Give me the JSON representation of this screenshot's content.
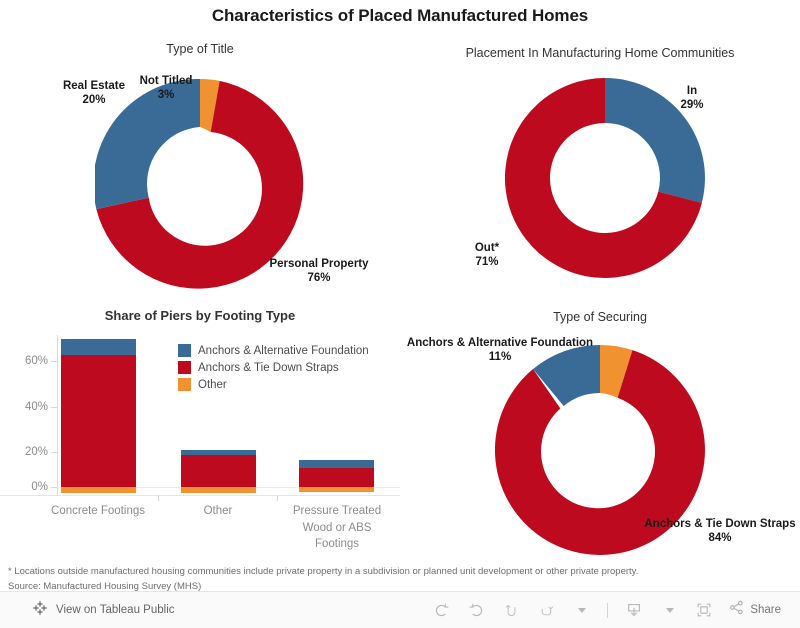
{
  "dashboard": {
    "title": "Characteristics of Placed Manufactured Homes",
    "footnote_1": "* Locations outside manufactured housing communities include private property in a subdivision or planned unit development or other private property.",
    "footnote_2": "Source: Manufactured Housing Survey (MHS)"
  },
  "colors": {
    "blue": "#3A6B96",
    "red": "#BD0A1E",
    "orange": "#F0922F",
    "axis": "#d9d9d9",
    "tick_text": "#8c8c8c"
  },
  "panels": {
    "type_of_title": {
      "title": "Type of Title"
    },
    "placement": {
      "title": "Placement In Manufacturing Home Communities"
    },
    "piers": {
      "title": "Share of Piers by Footing Type"
    },
    "securing": {
      "title": "Type of Securing"
    }
  },
  "chart_data": [
    {
      "id": "type-of-title",
      "type": "pie",
      "title": "Type of Title",
      "variant": "donut",
      "slices": [
        {
          "label": "Not Titled",
          "value": 3,
          "value_label": "3%",
          "color": "#F0922F"
        },
        {
          "label": "Personal Property",
          "value": 76,
          "value_label": "76%",
          "color": "#BD0A1E"
        },
        {
          "label": "Real Estate",
          "value": 20,
          "value_label": "20%",
          "color": "#3A6B96"
        }
      ],
      "units": "percent"
    },
    {
      "id": "placement-in-manufacturing-home-communities",
      "type": "pie",
      "title": "Placement In Manufacturing Home Communities",
      "variant": "donut",
      "slices": [
        {
          "label": "In",
          "value": 29,
          "value_label": "29%",
          "color": "#3A6B96"
        },
        {
          "label": "Out*",
          "value": 71,
          "value_label": "71%",
          "color": "#BD0A1E"
        }
      ],
      "units": "percent"
    },
    {
      "id": "share-of-piers-by-footing-type",
      "type": "bar",
      "subtype": "stacked",
      "title": "Share of Piers by Footing Type",
      "xlabel": "",
      "ylabel": "",
      "ylim": [
        -5,
        70
      ],
      "yticks": [
        0,
        20,
        40,
        60
      ],
      "ytick_labels": [
        "0%",
        "20%",
        "40%",
        "60%"
      ],
      "grid": false,
      "legend_position": "inside-top-right",
      "categories": [
        "Concrete Footings",
        "Other",
        "Pressure Treated Wood or ABS Footings"
      ],
      "series": [
        {
          "name": "Anchors & Alternative Foundation",
          "color": "#3A6B96",
          "values": [
            7,
            1,
            3
          ]
        },
        {
          "name": "Anchors & Tie Down Straps",
          "color": "#BD0A1E",
          "values": [
            61,
            16,
            10
          ]
        },
        {
          "name": "Other",
          "color": "#F0922F",
          "values": [
            -2,
            -2,
            -2
          ]
        }
      ]
    },
    {
      "id": "type-of-securing",
      "type": "pie",
      "title": "Type of Securing",
      "variant": "donut",
      "slices": [
        {
          "label": "Other",
          "value": 5,
          "value_label": "5%",
          "color": "#F0922F"
        },
        {
          "label": "Anchors & Tie Down Straps",
          "value": 84,
          "value_label": "84%",
          "color": "#BD0A1E"
        },
        {
          "label": "Anchors & Alternative Foundation",
          "value": 11,
          "value_label": "11%",
          "color": "#3A6B96"
        }
      ],
      "units": "percent"
    }
  ],
  "labels": {
    "title_real_estate": "Real Estate",
    "title_real_estate_pct": "20%",
    "title_not_titled": "Not Titled",
    "title_not_titled_pct": "3%",
    "title_personal_property": "Personal Property",
    "title_personal_property_pct": "76%",
    "placement_in": "In",
    "placement_in_pct": "29%",
    "placement_out": "Out*",
    "placement_out_pct": "71%",
    "securing_alt_foundation": "Anchors & Alternative Foundation",
    "securing_alt_foundation_pct": "11%",
    "securing_tie_down": "Anchors & Tie Down Straps",
    "securing_tie_down_pct": "84%"
  },
  "bar_axis": {
    "ticks": [
      "60%",
      "40%",
      "20%",
      "0%"
    ],
    "categories": [
      "Concrete Footings",
      "Other",
      "Pressure Treated Wood or ABS Footings"
    ]
  },
  "legend": {
    "items": [
      {
        "label": "Anchors & Alternative Foundation",
        "color": "#3A6B96"
      },
      {
        "label": "Anchors & Tie Down Straps",
        "color": "#BD0A1E"
      },
      {
        "label": "Other",
        "color": "#F0922F"
      }
    ]
  },
  "toolbar": {
    "view_on_tableau": "View on Tableau Public",
    "share_label": "Share",
    "icons": {
      "tableau": "tableau-logo-icon",
      "undo": "undo-icon",
      "redo": "redo-icon",
      "revert": "revert-icon",
      "refresh": "refresh-icon",
      "download": "download-icon",
      "fullscreen": "fullscreen-icon",
      "share": "share-icon"
    }
  }
}
